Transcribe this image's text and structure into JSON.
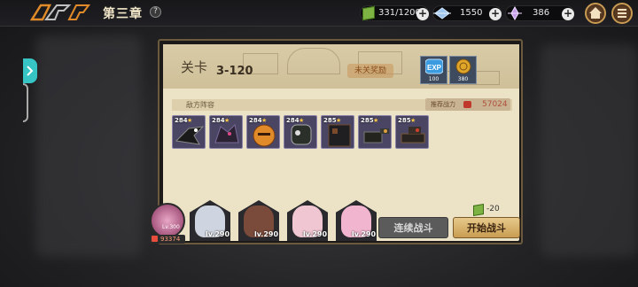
{
  "topbar": {
    "chapter_title": "第三章",
    "help_icon": "?",
    "resources": [
      {
        "name": "stamina",
        "icon": "green-cube-icon",
        "value": "331/1200"
      },
      {
        "name": "diamond",
        "icon": "blue-crystal-icon",
        "value": "1550"
      },
      {
        "name": "crystal",
        "icon": "purple-crystal-icon",
        "value": "386"
      }
    ],
    "plus": "+",
    "buttons": [
      "home-icon",
      "menu-icon"
    ]
  },
  "panel": {
    "stage_label": "关卡",
    "stage_number": "3-120",
    "drop_button": "未关奖励",
    "rewards": [
      {
        "icon": "exp-icon",
        "label": "EXP",
        "count": "100"
      },
      {
        "icon": "gold-coin-icon",
        "count": "380"
      }
    ],
    "enemy_section_title": "敌方阵容",
    "power_label": "推荐战力",
    "power_value": "57024",
    "enemies": [
      {
        "level": "284",
        "icon": "black-dragon-icon"
      },
      {
        "level": "284",
        "icon": "dark-wolf-icon"
      },
      {
        "level": "284",
        "icon": "pumpkin-knight-icon"
      },
      {
        "level": "284",
        "icon": "armored-beast-icon"
      },
      {
        "level": "285",
        "icon": "dark-mech-icon"
      },
      {
        "level": "285",
        "icon": "cannon-turret-icon"
      },
      {
        "level": "285",
        "icon": "siege-tank-icon"
      }
    ],
    "star": "★",
    "stamina_cost": "-20"
  },
  "team": {
    "leader_level": "Lv.300",
    "leader_gold": "93374",
    "heroes": [
      {
        "level": "lv.290",
        "icon": "silver-hair-hero-icon",
        "color": "#cfd5e0"
      },
      {
        "level": "lv.290",
        "icon": "witch-hat-hero-icon",
        "color": "#7a4a3a"
      },
      {
        "level": "lv.290",
        "icon": "pink-hair-hero-icon",
        "color": "#f0c6d2"
      },
      {
        "level": "lv.290",
        "icon": "bunny-hood-hero-icon",
        "color": "#f2b5cf"
      }
    ]
  },
  "actions": {
    "continuous_battle": "连续战斗",
    "start_battle": "开始战斗"
  }
}
